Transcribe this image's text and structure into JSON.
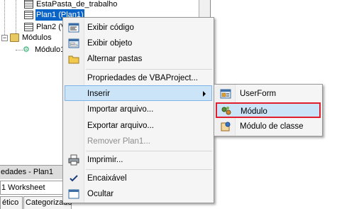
{
  "project_tree": {
    "items": [
      {
        "label": "EstaPasta_de_trabalho"
      },
      {
        "label": "Plan1 (Plan1)",
        "selected": true
      },
      {
        "label": "Plan2 (V"
      },
      {
        "label": "Módulos"
      },
      {
        "label": "Módulo1"
      }
    ]
  },
  "properties_panel": {
    "title": "edades - Plan1",
    "combo_value": "1 Worksheet",
    "tabs": [
      "ético",
      "Categorizado"
    ]
  },
  "context_menu": {
    "items": [
      {
        "label": "Exibir código",
        "icon": "code-window-icon"
      },
      {
        "label": "Exibir objeto",
        "icon": "form-view-icon"
      },
      {
        "label": "Alternar pastas",
        "icon": "folder-icon"
      },
      {
        "label": "Propriedades de VBAProject..."
      },
      {
        "label": "Inserir",
        "has_submenu": true,
        "highlighted": true
      },
      {
        "label": "Importar arquivo..."
      },
      {
        "label": "Exportar arquivo..."
      },
      {
        "label": "Remover Plan1...",
        "disabled": true
      },
      {
        "label": "Imprimir...",
        "icon": "printer-icon"
      },
      {
        "label": "Encaixável",
        "icon": "checkmark-icon",
        "checked": true
      },
      {
        "label": "Ocultar",
        "icon": "hide-window-icon"
      }
    ]
  },
  "submenu": {
    "items": [
      {
        "label": "UserForm",
        "icon": "userform-icon"
      },
      {
        "label": "Módulo",
        "icon": "module-icon",
        "highlighted": true
      },
      {
        "label": "Módulo de classe",
        "icon": "class-module-icon"
      }
    ]
  },
  "colors": {
    "selection": "#0a64c8",
    "menu_highlight": "#cce4f7",
    "submenu_highlight_border": "#e0202e"
  }
}
